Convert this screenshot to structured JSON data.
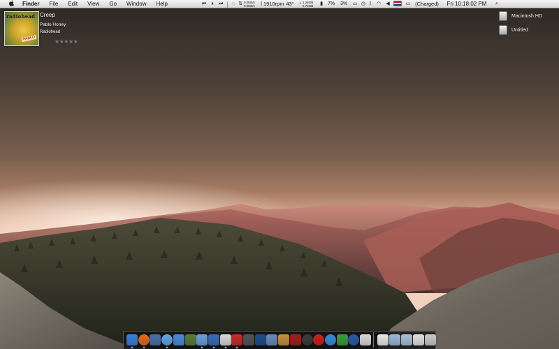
{
  "menubar": {
    "apple": "",
    "app_name": "Finder",
    "menus": [
      "File",
      "Edit",
      "View",
      "Go",
      "Window",
      "Help"
    ],
    "net_up": "0.0KB/s",
    "net_down": "0.0KB/s",
    "fan": "1910rpm",
    "temp": "43°",
    "mem_used": "1.26GB",
    "mem_free": "2.72GB",
    "cpu1": "7%",
    "cpu2": "3%",
    "battery_status": "(Charged)",
    "clock": "Fri 10:18:02 PM"
  },
  "now_playing": {
    "title": "Creep",
    "album": "Pablo Honey",
    "artist": "Radiohead",
    "album_art_band": "radiohead",
    "album_art_label": "PABLO",
    "rating_stars": "★★★★★"
  },
  "desktop_icons": [
    {
      "label": "Macintosh HD"
    },
    {
      "label": "Untitled"
    }
  ],
  "dock": {
    "apps": [
      {
        "name": "finder",
        "color": "#3b7fd6"
      },
      {
        "name": "firefox",
        "color": "#e2691e"
      },
      {
        "name": "preview",
        "color": "#4c6fa8"
      },
      {
        "name": "ichat",
        "color": "#5fa6e8"
      },
      {
        "name": "mail",
        "color": "#4c8ad8"
      },
      {
        "name": "iphoto",
        "color": "#5a7b3a"
      },
      {
        "name": "itunes",
        "color": "#6aa0d8"
      },
      {
        "name": "word",
        "color": "#3a6cb8"
      },
      {
        "name": "textedit",
        "color": "#d8d8d8"
      },
      {
        "name": "parallels",
        "color": "#c62a2a"
      },
      {
        "name": "inkscape",
        "color": "#555555"
      },
      {
        "name": "photoshop",
        "color": "#1d4d8c"
      },
      {
        "name": "cyberduck",
        "color": "#6a8ab8"
      },
      {
        "name": "guitar",
        "color": "#c09040"
      },
      {
        "name": "tm",
        "color": "#a02020"
      },
      {
        "name": "utility",
        "color": "#3c3c3c"
      },
      {
        "name": "growl",
        "color": "#c82020"
      },
      {
        "name": "safari",
        "color": "#3a8ad8"
      },
      {
        "name": "stickies",
        "color": "#3a9a3a"
      },
      {
        "name": "earth",
        "color": "#2a5aa8"
      },
      {
        "name": "calendar",
        "color": "#d8d8d8"
      }
    ],
    "docs": [
      {
        "name": "document",
        "color": "#e8e8e8"
      },
      {
        "name": "folder",
        "color": "#9ab8d8"
      },
      {
        "name": "downloads",
        "color": "#a8c0d8"
      },
      {
        "name": "stack",
        "color": "#e0e0e0"
      },
      {
        "name": "trash",
        "color": "#c8c8c8"
      }
    ]
  }
}
